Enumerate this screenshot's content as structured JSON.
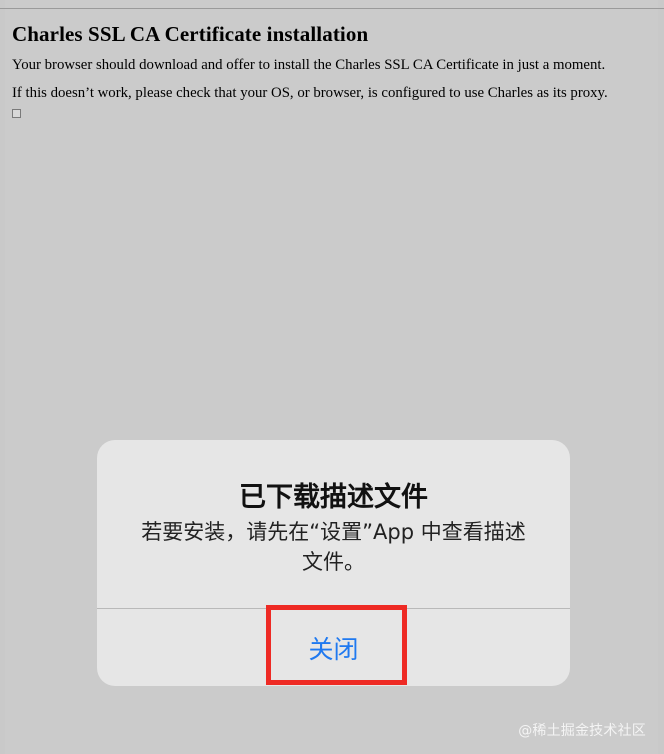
{
  "page": {
    "title": "Charles SSL CA Certificate installation",
    "paragraphs": [
      "Your browser should download and offer to install the Charles SSL CA Certificate in just a moment.",
      "If this doesn’t work, please check that your OS, or browser, is configured to use Charles as its proxy."
    ]
  },
  "dialog": {
    "title": "已下载描述文件",
    "message": "若要安装，请先在“设置”App 中查看描述文件。",
    "close_label": "关闭"
  },
  "watermark": "@稀土掘金技术社区",
  "colors": {
    "background": "#cbcbcb",
    "dialog_background": "#e6e6e6",
    "button_text": "#1f79f0",
    "highlight": "#ee2a24"
  }
}
